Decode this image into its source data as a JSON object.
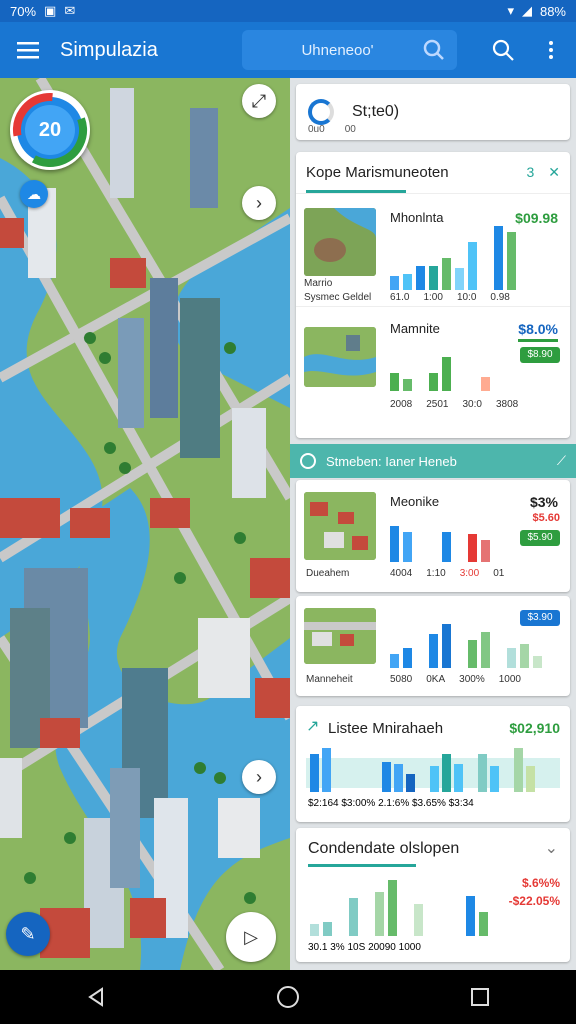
{
  "status": {
    "left_text": "70%",
    "right_text": "88%"
  },
  "app": {
    "title": "Simpulazia",
    "search_text": "Uhneneoo'"
  },
  "map": {
    "gauge_value": "20"
  },
  "top_card": {
    "title": "St;te0)",
    "sub_a": "0u0",
    "sub_b": "00"
  },
  "section1": {
    "title": "Kope Marismuneoten",
    "count": "3",
    "items": [
      {
        "name": "Mhonlnta",
        "price": "$09.98",
        "price_color": "#2e9d3f",
        "sub_a": "Marrio",
        "sub_b": "Sysmec Geldel",
        "ticks": [
          "61.0",
          "1:00",
          "10:0",
          "0.98"
        ]
      },
      {
        "name": "Mamnite",
        "price": "$8.0%",
        "price_color": "#1565c0",
        "chip": "$8.90",
        "chip_color": "#2e9d3f",
        "ticks": [
          "2008",
          "2501",
          "30:0",
          "3808"
        ]
      }
    ]
  },
  "banner": {
    "text": "Stmeben: Ianer Heneb"
  },
  "section2": {
    "items": [
      {
        "name": "Meonike",
        "price": "$3%",
        "price_color": "#222",
        "alt_price": "$5.60",
        "chip": "$5.90",
        "chip_color": "#2e9d3f",
        "sub_a": "Dueahem",
        "ticks": [
          "4004",
          "1:10",
          "3:00",
          "01"
        ]
      },
      {
        "name": "",
        "price": "",
        "chip": "$3.90",
        "chip_color": "#1976d2",
        "sub_a": "Manneheit",
        "ticks": [
          "5080",
          "0KA",
          "300%",
          "1000"
        ]
      }
    ]
  },
  "section3": {
    "title": "Listee Mnirahaeh",
    "price": "$02,910",
    "ticks": [
      "$2:164",
      "$3:00%",
      "2.1:6%",
      "$3.65%",
      "$3:34"
    ]
  },
  "section4": {
    "title": "Condendate olslopen",
    "price_a": "$.6%%",
    "price_b": "-$22.05%",
    "ticks": [
      "30.1",
      "3%",
      "10S",
      "20090",
      "1000"
    ]
  },
  "colors": {
    "appbar": "#1976d2",
    "teal": "#4db6ac",
    "green": "#2e9d3f",
    "red": "#e53935"
  },
  "icons": [
    "menu-icon",
    "search-icon",
    "more-vert-icon",
    "back-icon",
    "home-icon",
    "recents-icon"
  ]
}
